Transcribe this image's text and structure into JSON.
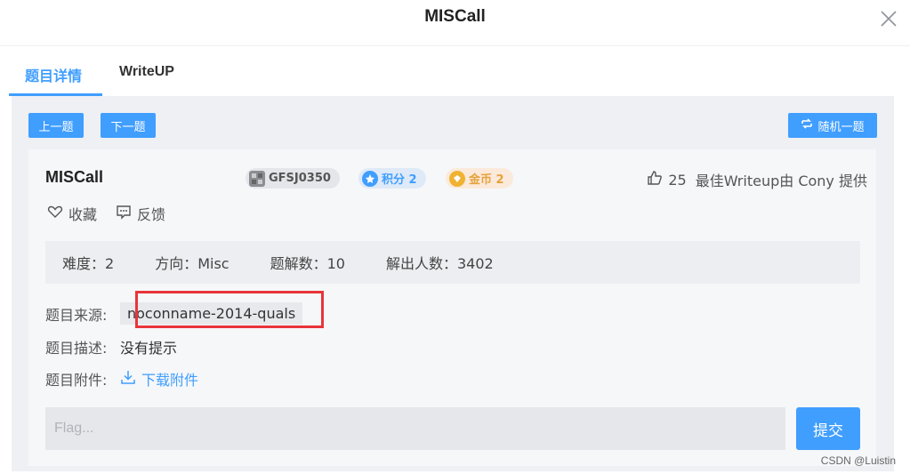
{
  "modal": {
    "title": "MISCall"
  },
  "tabs": [
    {
      "label": "题目详情",
      "active": true
    },
    {
      "label": "WriteUP",
      "active": false
    }
  ],
  "toolbar": {
    "prev_label": "上一题",
    "next_label": "下一题",
    "random_label": "随机一题"
  },
  "task": {
    "title": "MISCall",
    "id_badge": "GFSJ0350",
    "score_badge": "积分 2",
    "coin_badge": "金币 2",
    "likes": "25",
    "writeup_credit": "最佳Writeup由 Cony 提供",
    "favorite_label": "收藏",
    "feedback_label": "反馈"
  },
  "stats": {
    "difficulty": "难度：2",
    "direction": "方向：Misc",
    "solves": "题解数：10",
    "solvers": "解出人数：3402"
  },
  "details": {
    "source_label": "题目来源:",
    "source_value": "noconname-2014-quals",
    "description_label": "题目描述:",
    "description_value": "没有提示",
    "attachment_label": "题目附件:",
    "download_label": "下载附件"
  },
  "flag": {
    "placeholder": "Flag...",
    "value": ""
  },
  "submit_label": "提交",
  "watermark": "CSDN @Luistin",
  "colors": {
    "accent": "#409eff",
    "highlight": "#e8353a",
    "gold": "#e6a23c"
  }
}
